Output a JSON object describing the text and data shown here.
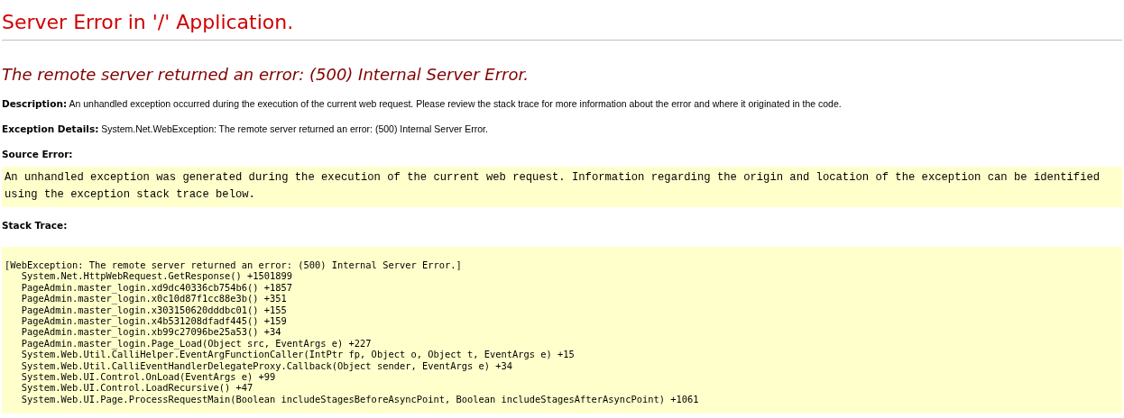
{
  "page_title": "Server Error in '/' Application.",
  "error_heading": "The remote server returned an error: (500) Internal Server Error.",
  "description": "**Description:** An unhandled exception occurred during the execution of the current web request. Please review the stack trace for more information about the error and where it originated in the code.",
  "exception_details": "**Exception Details:** System.Net.WebException: The remote server returned an error: (500) Internal Server Error.",
  "source_error": {
    "label": "Source Error:",
    "text": "An unhandled exception was generated during the execution of the current web request. Information regarding the origin and location of the exception can be identified using the exception stack trace below."
  },
  "stack_trace": {
    "label": "Stack Trace:",
    "lines": [
      "[WebException: The remote server returned an error: (500) Internal Server Error.]",
      "   System.Net.HttpWebRequest.GetResponse() +1501899",
      "   PageAdmin.master_login.xd9dc40336cb754b6() +1857",
      "   PageAdmin.master_login.x0c10d87f1cc88e3b() +351",
      "   PageAdmin.master_login.x303150620dddbc01() +155",
      "   PageAdmin.master_login.x4b531208dfadf445() +159",
      "   PageAdmin.master_login.xb99c27096be25a53() +34",
      "   PageAdmin.master_login.Page_Load(Object src, EventArgs e) +227",
      "   System.Web.Util.CalliHelper.EventArgFunctionCaller(IntPtr fp, Object o, Object t, EventArgs e) +15",
      "   System.Web.Util.CalliEventHandlerDelegateProxy.Callback(Object sender, EventArgs e) +34",
      "   System.Web.UI.Control.OnLoad(EventArgs e) +99",
      "   System.Web.UI.Control.LoadRecursive() +47",
      "   System.Web.UI.Page.ProcessRequestMain(Boolean includeStagesBeforeAsyncPoint, Boolean includeStagesAfterAsyncPoint) +1061"
    ]
  }
}
